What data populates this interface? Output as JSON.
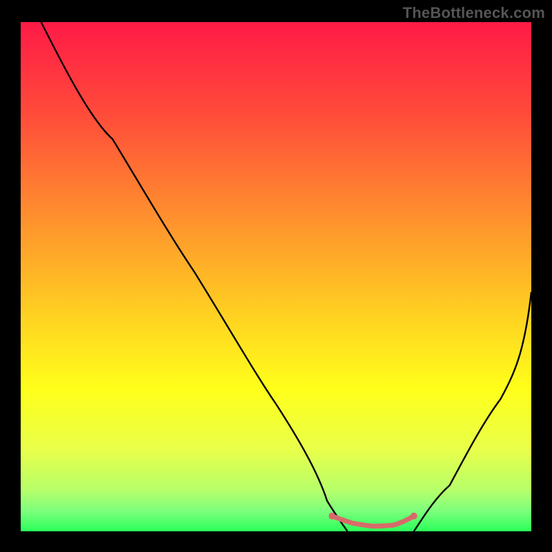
{
  "watermark": "TheBottleneck.com",
  "chart_data": {
    "type": "line",
    "title": "",
    "xlabel": "",
    "ylabel": "",
    "xlim": [
      0,
      100
    ],
    "ylim": [
      0,
      100
    ],
    "background_gradient": {
      "orientation": "vertical",
      "stops": [
        {
          "pos": 0.0,
          "color": "#ff1a47"
        },
        {
          "pos": 0.18,
          "color": "#ff4b3a"
        },
        {
          "pos": 0.38,
          "color": "#ff8f2e"
        },
        {
          "pos": 0.58,
          "color": "#ffd321"
        },
        {
          "pos": 0.72,
          "color": "#ffff1a"
        },
        {
          "pos": 0.84,
          "color": "#e8ff4a"
        },
        {
          "pos": 0.92,
          "color": "#b6ff6a"
        },
        {
          "pos": 0.96,
          "color": "#7dff7d"
        },
        {
          "pos": 1.0,
          "color": "#2aff5a"
        }
      ]
    },
    "series": [
      {
        "name": "bottleneck-curve-left",
        "color": "#000000",
        "x": [
          4,
          10,
          18,
          26,
          34,
          42,
          50,
          56,
          60,
          62,
          64
        ],
        "y": [
          100,
          90,
          77,
          64,
          51,
          38,
          25,
          14,
          6,
          2,
          0
        ]
      },
      {
        "name": "bottleneck-curve-right",
        "color": "#000000",
        "x": [
          77,
          80,
          84,
          88,
          92,
          96,
          100
        ],
        "y": [
          0,
          3,
          9,
          17,
          26,
          36,
          47
        ]
      },
      {
        "name": "optimal-flat-marker",
        "color": "#d86a6a",
        "x": [
          61,
          63,
          65,
          67,
          69,
          71,
          73,
          75,
          77
        ],
        "y": [
          3,
          2.2,
          1.6,
          1.2,
          1.0,
          1.0,
          1.2,
          1.8,
          3
        ]
      }
    ],
    "optimal_range_pct": [
      61,
      77
    ]
  }
}
